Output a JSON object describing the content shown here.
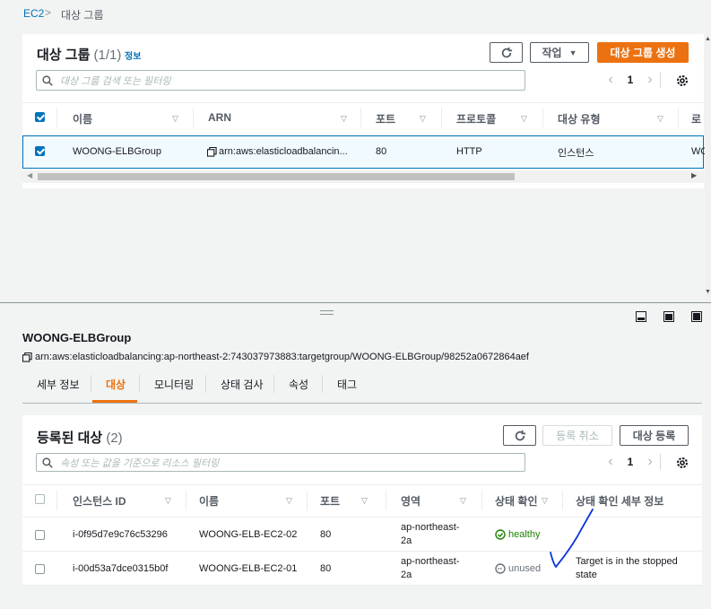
{
  "breadcrumb": {
    "root": "EC2",
    "sep": ">",
    "current": "대상 그룹"
  },
  "top_panel": {
    "title": "대상 그룹",
    "count": "(1/1)",
    "info": "정보",
    "refresh_icon": "refresh-icon",
    "actions_label": "작업",
    "create_label": "대상 그룹 생성",
    "search_placeholder": "대상 그룹 검색 또는 필터링",
    "page": "1",
    "columns": [
      "이름",
      "ARN",
      "포트",
      "프로토콜",
      "대상 유형",
      "로"
    ],
    "row": {
      "name": "WOONG-ELBGroup",
      "arn": "arn:aws:elasticloadbalancin...",
      "port": "80",
      "protocol": "HTTP",
      "target_type": "인스턴스",
      "lb": "WO"
    }
  },
  "detail": {
    "title": "WOONG-ELBGroup",
    "arn": "arn:aws:elasticloadbalancing:ap-northeast-2:743037973883:targetgroup/WOONG-ELBGroup/98252a0672864aef",
    "tabs": [
      "세부 정보",
      "대상",
      "모니터링",
      "상태 검사",
      "속성",
      "태그"
    ],
    "active_tab": "대상"
  },
  "targets": {
    "title": "등록된 대상",
    "count": "(2)",
    "deregister_label": "등록 취소",
    "register_label": "대상 등록",
    "search_placeholder": "속성 또는 값을 기준으로 리소스 필터링",
    "page": "1",
    "columns": [
      "인스턴스 ID",
      "이름",
      "포트",
      "영역",
      "상태 확인",
      "상태 확인 세부 정보"
    ],
    "rows": [
      {
        "id": "i-0f95d7e9c76c53296",
        "name": "WOONG-ELB-EC2-02",
        "port": "80",
        "zone1": "ap-northeast-",
        "zone2": "2a",
        "status": "healthy",
        "details1": "",
        "details2": ""
      },
      {
        "id": "i-00d53a7dce0315b0f",
        "name": "WOONG-ELB-EC2-01",
        "port": "80",
        "zone1": "ap-northeast-",
        "zone2": "2a",
        "status": "unused",
        "details1": "Target is in the stopped",
        "details2": "state"
      }
    ],
    "colors": {
      "healthy": "#1d8102",
      "unused": "#687078",
      "annotation": "#0a35e0"
    }
  }
}
